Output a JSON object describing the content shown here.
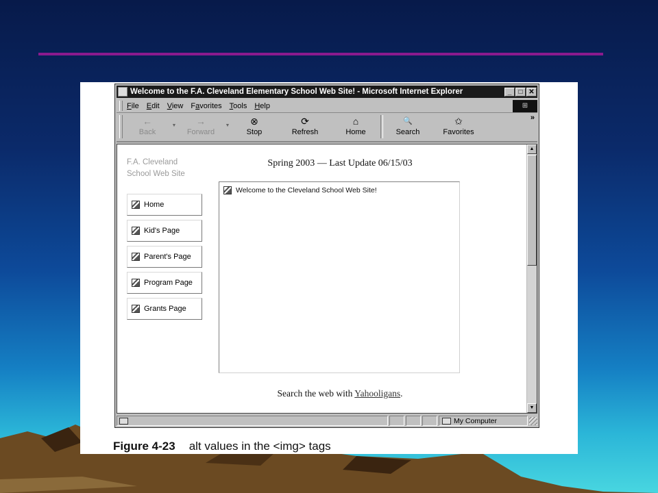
{
  "slide": {
    "colors": {
      "rule": "#8a1a8e",
      "bg_top": "#071a4a",
      "bg_bottom": "#48d6e0"
    }
  },
  "browser": {
    "title": "Welcome to the F.A. Cleveland Elementary School Web Site! - Microsoft Internet Explorer",
    "window_buttons": {
      "minimize": "_",
      "maximize": "□",
      "close": "✕"
    },
    "menu": [
      {
        "key": "F",
        "rest": "ile"
      },
      {
        "key": "E",
        "rest": "dit"
      },
      {
        "key": "V",
        "rest": "iew"
      },
      {
        "pre": "F",
        "key": "a",
        "rest": "vorites"
      },
      {
        "key": "T",
        "rest": "ools"
      },
      {
        "key": "H",
        "rest": "elp"
      }
    ],
    "toolbar": {
      "back": "Back",
      "forward": "Forward",
      "stop": "Stop",
      "refresh": "Refresh",
      "home": "Home",
      "search": "Search",
      "favorites": "Favorites",
      "more": "»"
    },
    "icons": {
      "back": "←",
      "forward": "→",
      "stop": "⊗",
      "refresh": "⟳",
      "home": "⌂",
      "search": "🔍",
      "favorites": "✩",
      "dropdown": "▼",
      "scroll_up": "▲",
      "scroll_down": "▼"
    },
    "status": {
      "zone": "My Computer"
    }
  },
  "page": {
    "site_name": "F.A. Cleveland School Web Site",
    "header": "Spring 2003 — Last Update 06/15/03",
    "nav": [
      "Home",
      "Kid's Page",
      "Parent's Page",
      "Program Page",
      "Grants Page"
    ],
    "content_alt": "Welcome to the Cleveland School Web Site!",
    "search_prefix": "Search the web with",
    "search_link": "Yahooligans",
    "search_suffix": "."
  },
  "caption": {
    "number": "Figure 4-23",
    "text": "alt values in the <img> tags"
  }
}
